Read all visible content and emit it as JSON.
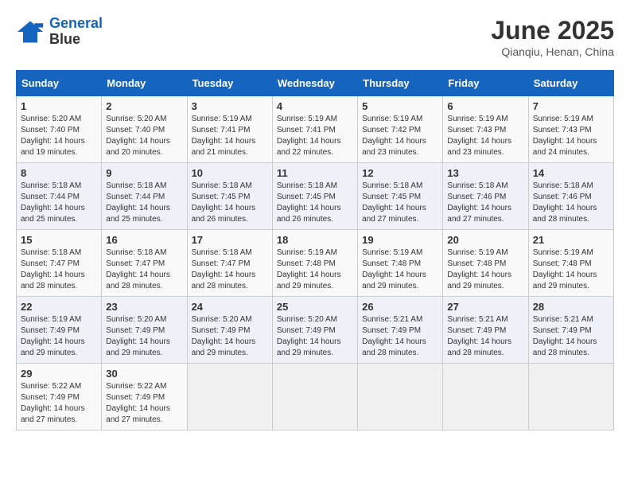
{
  "logo": {
    "line1": "General",
    "line2": "Blue"
  },
  "title": "June 2025",
  "subtitle": "Qianqiu, Henan, China",
  "weekdays": [
    "Sunday",
    "Monday",
    "Tuesday",
    "Wednesday",
    "Thursday",
    "Friday",
    "Saturday"
  ],
  "weeks": [
    [
      {
        "day": "1",
        "sunrise": "5:20 AM",
        "sunset": "7:40 PM",
        "daylight": "14 hours and 19 minutes."
      },
      {
        "day": "2",
        "sunrise": "5:20 AM",
        "sunset": "7:40 PM",
        "daylight": "14 hours and 20 minutes."
      },
      {
        "day": "3",
        "sunrise": "5:19 AM",
        "sunset": "7:41 PM",
        "daylight": "14 hours and 21 minutes."
      },
      {
        "day": "4",
        "sunrise": "5:19 AM",
        "sunset": "7:41 PM",
        "daylight": "14 hours and 22 minutes."
      },
      {
        "day": "5",
        "sunrise": "5:19 AM",
        "sunset": "7:42 PM",
        "daylight": "14 hours and 23 minutes."
      },
      {
        "day": "6",
        "sunrise": "5:19 AM",
        "sunset": "7:43 PM",
        "daylight": "14 hours and 23 minutes."
      },
      {
        "day": "7",
        "sunrise": "5:19 AM",
        "sunset": "7:43 PM",
        "daylight": "14 hours and 24 minutes."
      }
    ],
    [
      {
        "day": "8",
        "sunrise": "5:18 AM",
        "sunset": "7:44 PM",
        "daylight": "14 hours and 25 minutes."
      },
      {
        "day": "9",
        "sunrise": "5:18 AM",
        "sunset": "7:44 PM",
        "daylight": "14 hours and 25 minutes."
      },
      {
        "day": "10",
        "sunrise": "5:18 AM",
        "sunset": "7:45 PM",
        "daylight": "14 hours and 26 minutes."
      },
      {
        "day": "11",
        "sunrise": "5:18 AM",
        "sunset": "7:45 PM",
        "daylight": "14 hours and 26 minutes."
      },
      {
        "day": "12",
        "sunrise": "5:18 AM",
        "sunset": "7:45 PM",
        "daylight": "14 hours and 27 minutes."
      },
      {
        "day": "13",
        "sunrise": "5:18 AM",
        "sunset": "7:46 PM",
        "daylight": "14 hours and 27 minutes."
      },
      {
        "day": "14",
        "sunrise": "5:18 AM",
        "sunset": "7:46 PM",
        "daylight": "14 hours and 28 minutes."
      }
    ],
    [
      {
        "day": "15",
        "sunrise": "5:18 AM",
        "sunset": "7:47 PM",
        "daylight": "14 hours and 28 minutes."
      },
      {
        "day": "16",
        "sunrise": "5:18 AM",
        "sunset": "7:47 PM",
        "daylight": "14 hours and 28 minutes."
      },
      {
        "day": "17",
        "sunrise": "5:18 AM",
        "sunset": "7:47 PM",
        "daylight": "14 hours and 28 minutes."
      },
      {
        "day": "18",
        "sunrise": "5:19 AM",
        "sunset": "7:48 PM",
        "daylight": "14 hours and 29 minutes."
      },
      {
        "day": "19",
        "sunrise": "5:19 AM",
        "sunset": "7:48 PM",
        "daylight": "14 hours and 29 minutes."
      },
      {
        "day": "20",
        "sunrise": "5:19 AM",
        "sunset": "7:48 PM",
        "daylight": "14 hours and 29 minutes."
      },
      {
        "day": "21",
        "sunrise": "5:19 AM",
        "sunset": "7:48 PM",
        "daylight": "14 hours and 29 minutes."
      }
    ],
    [
      {
        "day": "22",
        "sunrise": "5:19 AM",
        "sunset": "7:49 PM",
        "daylight": "14 hours and 29 minutes."
      },
      {
        "day": "23",
        "sunrise": "5:20 AM",
        "sunset": "7:49 PM",
        "daylight": "14 hours and 29 minutes."
      },
      {
        "day": "24",
        "sunrise": "5:20 AM",
        "sunset": "7:49 PM",
        "daylight": "14 hours and 29 minutes."
      },
      {
        "day": "25",
        "sunrise": "5:20 AM",
        "sunset": "7:49 PM",
        "daylight": "14 hours and 29 minutes."
      },
      {
        "day": "26",
        "sunrise": "5:21 AM",
        "sunset": "7:49 PM",
        "daylight": "14 hours and 28 minutes."
      },
      {
        "day": "27",
        "sunrise": "5:21 AM",
        "sunset": "7:49 PM",
        "daylight": "14 hours and 28 minutes."
      },
      {
        "day": "28",
        "sunrise": "5:21 AM",
        "sunset": "7:49 PM",
        "daylight": "14 hours and 28 minutes."
      }
    ],
    [
      {
        "day": "29",
        "sunrise": "5:22 AM",
        "sunset": "7:49 PM",
        "daylight": "14 hours and 27 minutes."
      },
      {
        "day": "30",
        "sunrise": "5:22 AM",
        "sunset": "7:49 PM",
        "daylight": "14 hours and 27 minutes."
      },
      null,
      null,
      null,
      null,
      null
    ]
  ]
}
